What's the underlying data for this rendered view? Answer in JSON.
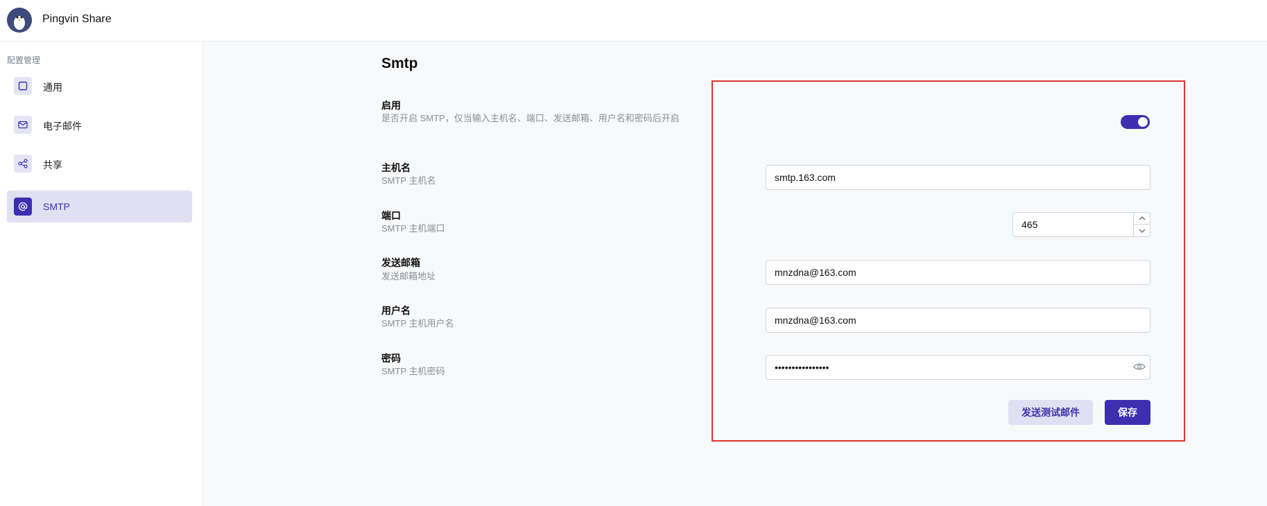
{
  "header": {
    "app_name": "Pingvin Share"
  },
  "sidebar": {
    "section_title": "配置管理",
    "items": [
      {
        "label": "通用",
        "icon": "square-icon",
        "active": false
      },
      {
        "label": "电子邮件",
        "icon": "mail-icon",
        "active": false
      },
      {
        "label": "共享",
        "icon": "share-icon",
        "active": false
      },
      {
        "label": "SMTP",
        "icon": "at-icon",
        "active": true
      }
    ]
  },
  "main": {
    "title": "Smtp",
    "fields": {
      "enable": {
        "label": "启用",
        "description": "是否开启 SMTP，仅当输入主机名、端口、发送邮箱、用户名和密码后开启",
        "value": true
      },
      "host": {
        "label": "主机名",
        "description": "SMTP 主机名",
        "value": "smtp.163.com"
      },
      "port": {
        "label": "端口",
        "description": "SMTP 主机端口",
        "value": "465"
      },
      "sender": {
        "label": "发送邮箱",
        "description": "发送邮箱地址",
        "value": "mnzdna@163.com"
      },
      "username": {
        "label": "用户名",
        "description": "SMTP 主机用户名",
        "value": "mnzdna@163.com"
      },
      "password": {
        "label": "密码",
        "description": "SMTP 主机密码",
        "value": "••••••••••••••••"
      }
    },
    "buttons": {
      "test_label": "发送测试邮件",
      "save_label": "保存"
    }
  },
  "colors": {
    "accent": "#3d2fb0",
    "accent_light": "#e1e0f3",
    "highlight_border": "#e03131"
  }
}
